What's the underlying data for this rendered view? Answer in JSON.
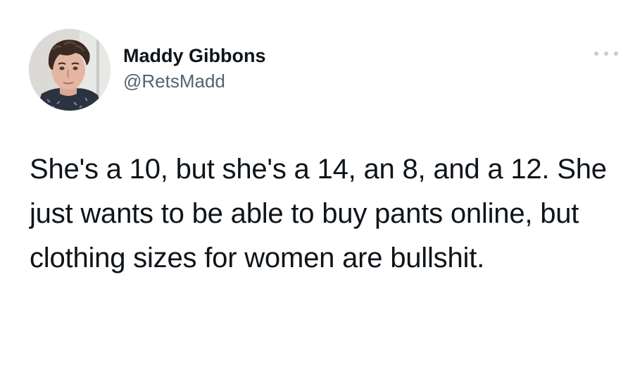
{
  "tweet": {
    "author": {
      "display_name": "Maddy Gibbons",
      "handle": "@RetsMadd",
      "avatar_icon": "profile-photo"
    },
    "menu_icon": "more-options-icon",
    "text": "She's a 10, but she's a 14, an 8, and a 12. She just wants to be able to buy pants online, but clothing sizes for women are bullshit."
  },
  "colors": {
    "background": "#ffffff",
    "text_primary": "#0f1419",
    "text_secondary": "#536471",
    "menu_dots": "#c6cdd3"
  }
}
